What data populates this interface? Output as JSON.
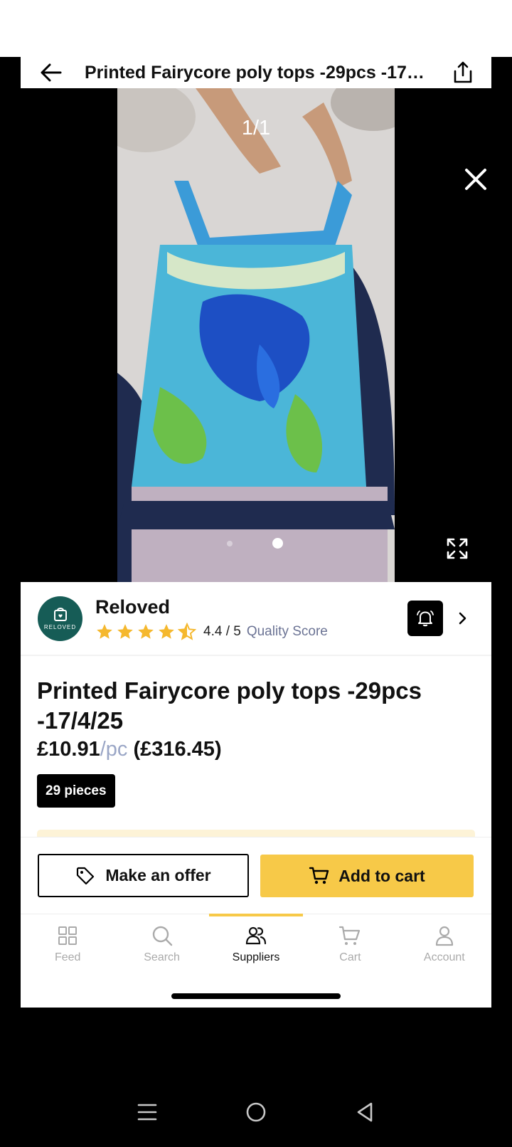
{
  "header": {
    "title": "Printed Fairycore poly tops -29pcs -17/4/25",
    "back_icon": "arrow-left-icon",
    "share_icon": "share-icon"
  },
  "media": {
    "counter": "1/1",
    "close_icon": "close-icon",
    "expand_icon": "expand-icon",
    "dots_total": 2,
    "dots_active": 2
  },
  "seller": {
    "name": "Reloved",
    "logo_text": "RELOVED",
    "rating_value": 4.4,
    "rating_text": "4.4 / 5",
    "quality_label": "Quality Score",
    "bell_icon": "notification-bell-icon",
    "chevron_icon": "chevron-right-icon"
  },
  "product": {
    "title": "Printed Fairycore poly tops -29pcs -17/4/25",
    "unit_price": "£10.91",
    "unit_suffix": "/pc",
    "total_price": "(£316.45)",
    "pieces_badge": "29 pieces"
  },
  "actions": {
    "offer_label": "Make an offer",
    "cart_label": "Add to cart"
  },
  "nav": {
    "items": [
      {
        "label": "Feed",
        "icon": "grid-icon",
        "active": false
      },
      {
        "label": "Search",
        "icon": "search-icon",
        "active": false
      },
      {
        "label": "Suppliers",
        "icon": "users-icon",
        "active": true
      },
      {
        "label": "Cart",
        "icon": "cart-icon",
        "active": false
      },
      {
        "label": "Account",
        "icon": "user-icon",
        "active": false
      }
    ]
  },
  "colors": {
    "accent": "#f7c948",
    "star": "#f5b82e",
    "logo_bg": "#165c56",
    "muted_blue": "#6b7394"
  }
}
